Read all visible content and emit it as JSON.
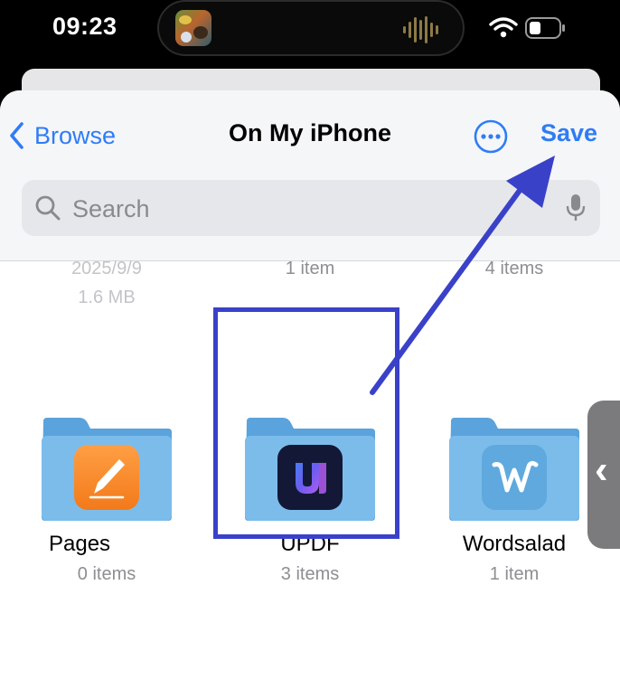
{
  "status_bar": {
    "time": "09:23",
    "icons": [
      "now-playing-thumbnail",
      "audio-waveform-icon",
      "wifi-icon",
      "battery-icon"
    ]
  },
  "nav": {
    "back_label": "Browse",
    "title": "On My iPhone",
    "save_label": "Save",
    "more_icon": "ellipsis-circle-icon"
  },
  "search": {
    "placeholder": "Search",
    "icons": [
      "search-icon",
      "microphone-icon"
    ]
  },
  "partial_row": [
    {
      "line1": "2025/9/9",
      "line2": "1.6 MB"
    },
    {
      "line1": "1 item"
    },
    {
      "line1": "4 items"
    }
  ],
  "folders": [
    {
      "name": "Pages",
      "count": "0 items",
      "app_icon": "pages-app-icon"
    },
    {
      "name": "UPDF",
      "count": "3 items",
      "app_icon": "updf-app-icon"
    },
    {
      "name": "Wordsalad",
      "count": "1 item",
      "app_icon": "wordsalad-app-icon"
    }
  ],
  "annotations": {
    "highlight_color": "#3a41c9",
    "arrow_color": "#3a41c9"
  },
  "colors": {
    "accent": "#2f7cf6",
    "folder": "#6fb3e6"
  }
}
